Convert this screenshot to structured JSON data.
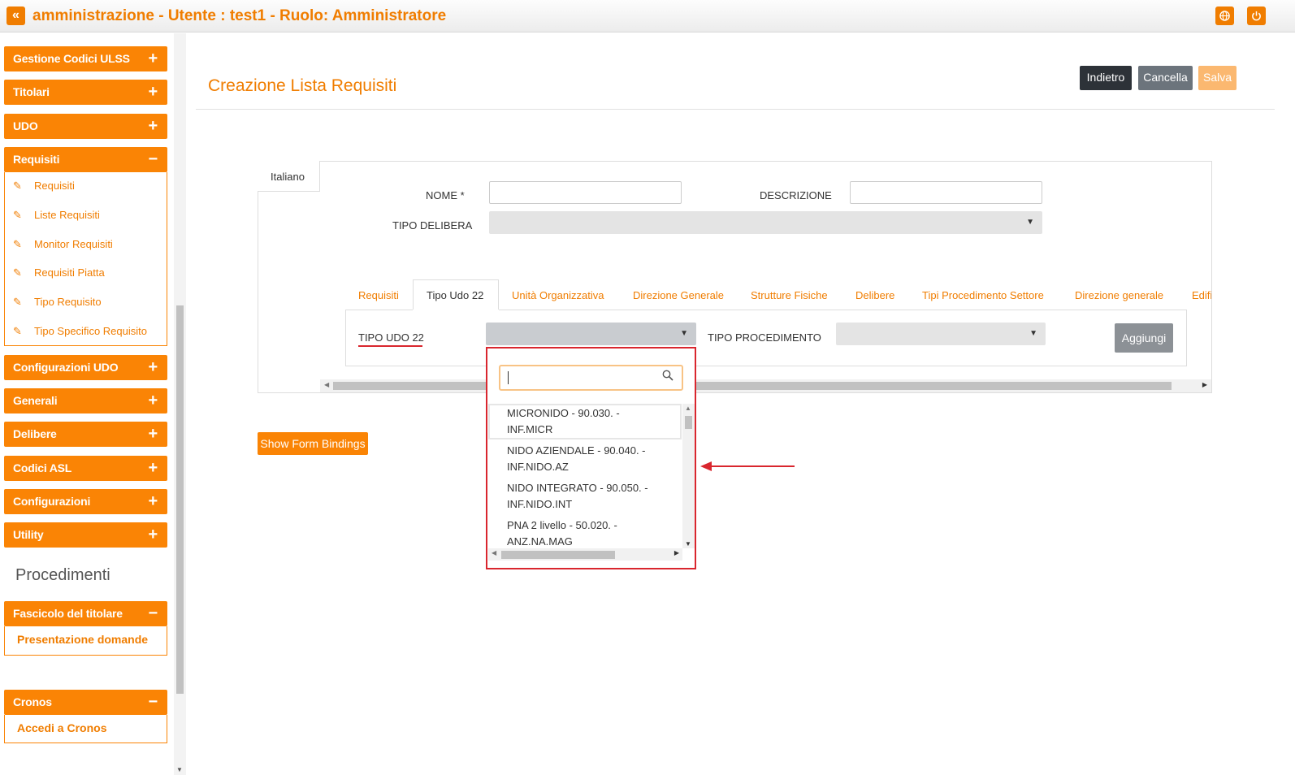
{
  "header": {
    "collapse_icon": "«",
    "title": "amministrazione - Utente : test1 - Ruolo: Amministratore",
    "accent": "#f07d00"
  },
  "sidebar": {
    "menus": [
      {
        "label": "Gestione Codici ULSS",
        "toggle": "+"
      },
      {
        "label": "Titolari",
        "toggle": "+"
      },
      {
        "label": "UDO",
        "toggle": "+"
      },
      {
        "label": "Requisiti",
        "toggle": "−"
      },
      {
        "label": "Configurazioni UDO",
        "toggle": "+"
      },
      {
        "label": "Generali",
        "toggle": "+"
      },
      {
        "label": "Delibere",
        "toggle": "+"
      },
      {
        "label": "Codici ASL",
        "toggle": "+"
      },
      {
        "label": "Configurazioni",
        "toggle": "+"
      },
      {
        "label": "Utility",
        "toggle": "+"
      }
    ],
    "requisiti_items": [
      {
        "label": "Requisiti"
      },
      {
        "label": "Liste Requisiti"
      },
      {
        "label": "Monitor Requisiti"
      },
      {
        "label": "Requisiti Piatta"
      },
      {
        "label": "Tipo Requisito"
      },
      {
        "label": "Tipo Specifico Requisito"
      }
    ],
    "section_title": "Procedimenti",
    "fascicolo": {
      "label": "Fascicolo del titolare",
      "toggle": "−",
      "item": "Presentazione domande"
    },
    "cronos": {
      "label": "Cronos",
      "toggle": "−",
      "item": "Accedi a Cronos"
    }
  },
  "main": {
    "title": "Creazione Lista Requisiti",
    "buttons": {
      "back": "Indietro",
      "cancel": "Cancella",
      "save": "Salva"
    },
    "lang_tab": "Italiano",
    "fields": {
      "nome_label": "NOME *",
      "descrizione_label": "DESCRIZIONE",
      "tipo_delibera_label": "TIPO DELIBERA",
      "nome_value": "",
      "descrizione_value": ""
    },
    "tabs": [
      {
        "label": "Requisiti"
      },
      {
        "label": "Tipo Udo 22"
      },
      {
        "label": "Unità Organizzativa"
      },
      {
        "label": "Direzione Generale"
      },
      {
        "label": "Strutture Fisiche"
      },
      {
        "label": "Delibere"
      },
      {
        "label": "Tipi Procedimento Settore"
      },
      {
        "label": "Direzione generale"
      },
      {
        "label": "Edifi"
      }
    ],
    "tab_pane": {
      "tipo_udo_label": "TIPO UDO 22",
      "tipo_procedimento_label": "TIPO PROCEDIMENTO",
      "add_button": "Aggiungi"
    },
    "show_bindings": "Show Form Bindings"
  },
  "dropdown": {
    "search_value": "",
    "options": [
      {
        "line1": "MICRONIDO - 90.030. -",
        "line2": "INF.MICR"
      },
      {
        "line1": "NIDO AZIENDALE - 90.040. -",
        "line2": "INF.NIDO.AZ"
      },
      {
        "line1": "NIDO INTEGRATO - 90.050. -",
        "line2": "INF.NIDO.INT"
      },
      {
        "line1": "PNA 2 livello - 50.020. -",
        "line2": "ANZ.NA.MAG"
      }
    ]
  }
}
